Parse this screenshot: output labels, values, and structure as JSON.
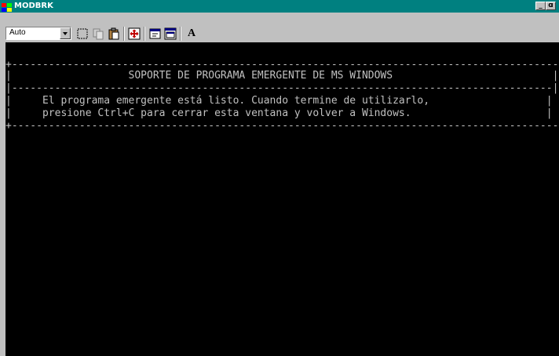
{
  "window": {
    "title": "MODBRK",
    "minimize_label": "_",
    "maximize_label": "ɑ"
  },
  "toolbar": {
    "font_size_value": "Auto",
    "font_button_label": "A"
  },
  "console": {
    "box_top_border": "+------------------------------------------------------------------------------------------+",
    "header_line": "|                   SOPORTE DE PROGRAMA EMERGENTE DE MS WINDOWS                          |",
    "mid_border": "|----------------------------------------------------------------------------------------|",
    "message_line_1": "|     El programa emergente está listo. Cuando termine de utilizarlo,                   |",
    "message_line_2": "|     presione Ctrl+C para cerrar esta ventana y volver a Windows.                      |",
    "box_bottom_border": "+------------------------------------------------------------------------------------------+"
  },
  "colors": {
    "titlebar": "#008080",
    "console_bg": "#000000",
    "console_fg": "#c0c0c0"
  }
}
